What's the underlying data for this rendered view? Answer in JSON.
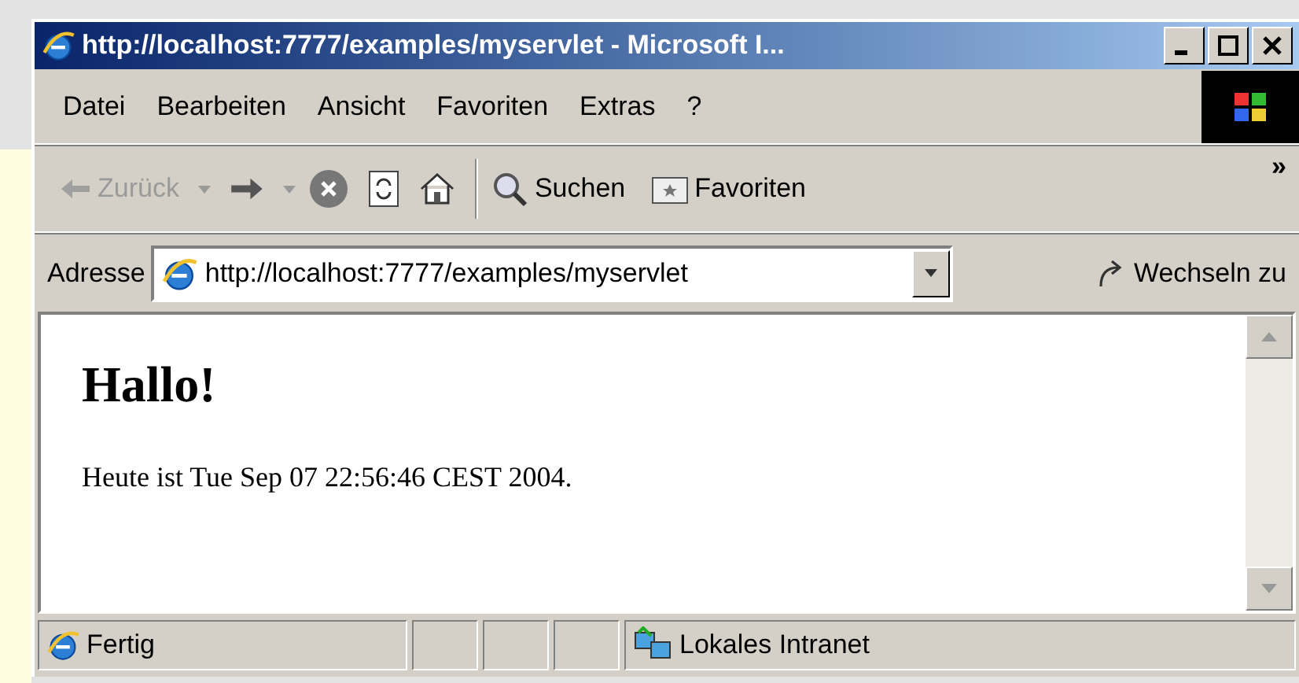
{
  "window": {
    "title": "http://localhost:7777/examples/myservlet - Microsoft I..."
  },
  "menu": [
    "Datei",
    "Bearbeiten",
    "Ansicht",
    "Favoriten",
    "Extras",
    "?"
  ],
  "toolbar": [
    {
      "kind": "back",
      "label": "Zurück",
      "disabled": true
    },
    {
      "kind": "forward",
      "disabled": false
    },
    {
      "kind": "stop"
    },
    {
      "kind": "refresh"
    },
    {
      "kind": "home"
    },
    {
      "kind": "separator"
    },
    {
      "kind": "search",
      "label": "Suchen"
    },
    {
      "kind": "favorites",
      "label": "Favoriten"
    },
    {
      "kind": "more",
      "label": "»"
    }
  ],
  "address": {
    "label": "Adresse",
    "value": "http://localhost:7777/examples/myservlet",
    "go": "Wechseln zu"
  },
  "page": {
    "heading": "Hallo!",
    "text": "Heute ist Tue Sep 07 22:56:46 CEST 2004."
  },
  "status_bar": {
    "text": "Fertig",
    "zone": "Lokales Intranet"
  }
}
